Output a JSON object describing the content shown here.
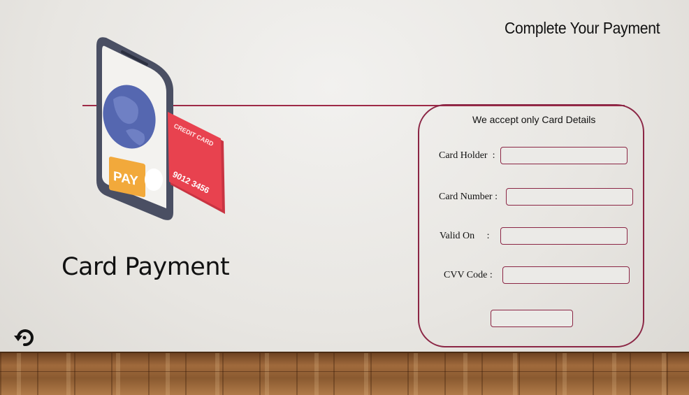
{
  "slide": {
    "title": "Complete Your Payment",
    "heading": "Card Payment"
  },
  "illustration": {
    "pay_label": "PAY",
    "card_label": "CREDIT CARD",
    "card_number": "9012 3456",
    "icons": [
      "phone-icon",
      "globe-icon",
      "credit-card-icon"
    ]
  },
  "form": {
    "caption": "We accept only Card Details",
    "fields": [
      {
        "label": "Card Holder  :",
        "value": "",
        "placeholder": ""
      },
      {
        "label": "Card Number :",
        "value": "",
        "placeholder": ""
      },
      {
        "label": "Valid On     :",
        "value": "",
        "placeholder": ""
      },
      {
        "label": "CVV Code :",
        "value": "",
        "placeholder": ""
      }
    ],
    "submit_label": ""
  },
  "colors": {
    "accent": "#8b2645",
    "rule": "#9e2a47",
    "card": "#e8424f",
    "pay_button": "#f2a93b",
    "globe": "#5567b0",
    "phone_frame": "#4a4f63"
  },
  "footer": {
    "icon": "refresh-icon"
  }
}
